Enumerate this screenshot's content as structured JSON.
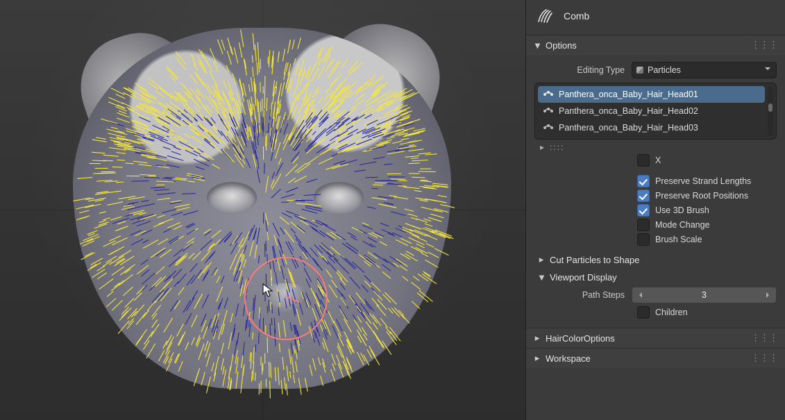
{
  "tool": {
    "name": "Comb"
  },
  "options": {
    "title": "Options",
    "editing_type_label": "Editing Type",
    "editing_type_value": "Particles",
    "particle_systems": [
      "Panthera_onca_Baby_Hair_Head01",
      "Panthera_onca_Baby_Hair_Head02",
      "Panthera_onca_Baby_Hair_Head03"
    ],
    "checks": {
      "x_mirror": {
        "label": "X",
        "on": false
      },
      "preserve_lengths": {
        "label": "Preserve Strand Lengths",
        "on": true
      },
      "preserve_roots": {
        "label": "Preserve Root Positions",
        "on": true
      },
      "use_3d_brush": {
        "label": "Use 3D Brush",
        "on": true
      },
      "mode_change": {
        "label": "Mode Change",
        "on": false
      },
      "brush_scale": {
        "label": "Brush Scale",
        "on": false
      }
    },
    "cut_particles_title": "Cut Particles to Shape",
    "viewport_display": {
      "title": "Viewport Display",
      "path_steps_label": "Path Steps",
      "path_steps_value": "3",
      "children": {
        "label": "Children",
        "on": false
      }
    }
  },
  "sections": {
    "hair_color": "HairColorOptions",
    "workspace": "Workspace"
  }
}
